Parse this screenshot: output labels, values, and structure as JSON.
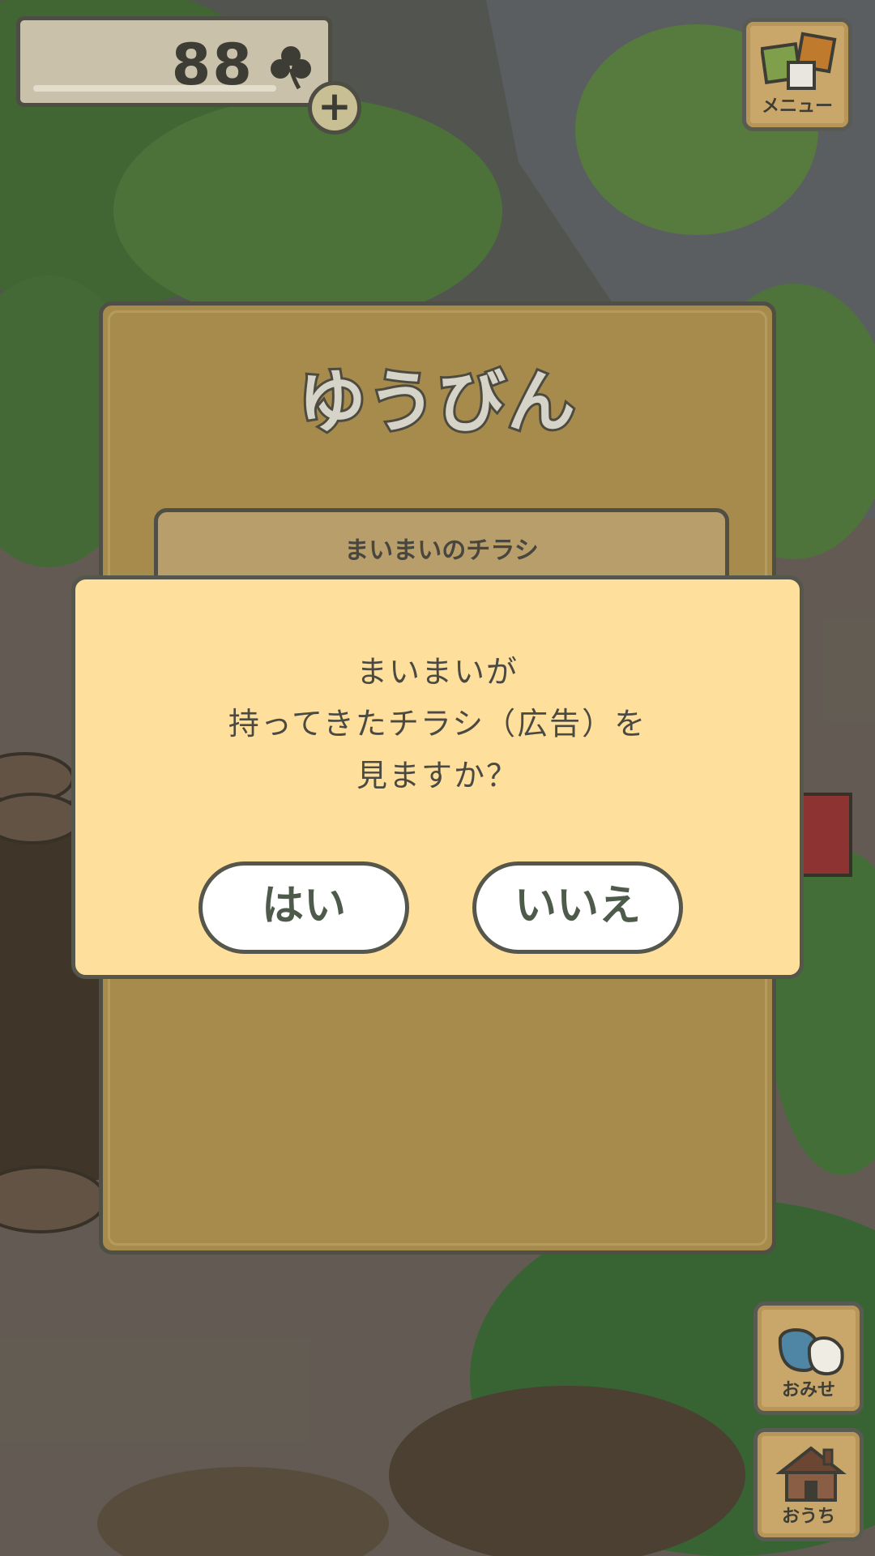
{
  "header": {
    "clover_count": "88",
    "clover_icon": "clover-icon",
    "add_icon": "plus-icon"
  },
  "side_buttons": {
    "menu_label": "メニュー",
    "shop_label": "おみせ",
    "home_label": "おうち"
  },
  "mail": {
    "title": "ゆうびん",
    "items": [
      {
        "name": "まいまいのチラシ"
      }
    ]
  },
  "dialog": {
    "lines": [
      "まいまいが",
      "持ってきたチラシ（広告）を",
      "見ますか？"
    ],
    "yes_label": "はい",
    "no_label": "いいえ"
  },
  "colors": {
    "dialog_bg": "#ffdf9c",
    "panel_bg": "#a68b4d",
    "outline": "#4f4f45",
    "button_bg": "#ffffff",
    "button_text": "#4e5a4a"
  }
}
